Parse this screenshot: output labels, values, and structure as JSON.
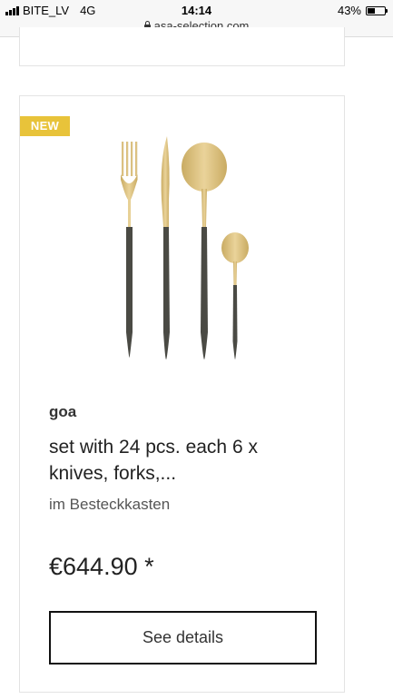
{
  "status_bar": {
    "carrier": "BITE_LV",
    "network": "4G",
    "time": "14:14",
    "battery_percent": "43%",
    "battery_level": 0.43,
    "url": "asa-selection.com"
  },
  "product": {
    "badge": "NEW",
    "brand": "goa",
    "title": "set with 24 pcs. each 6 x knives, forks,...",
    "subtitle": "im Besteckkasten",
    "price": "€644.90 *",
    "details_label": "See details",
    "image_icon": "cutlery-set-image"
  },
  "colors": {
    "badge": "#e8c33a",
    "gold": "#d9bf7c",
    "handle": "#4a4a44"
  }
}
